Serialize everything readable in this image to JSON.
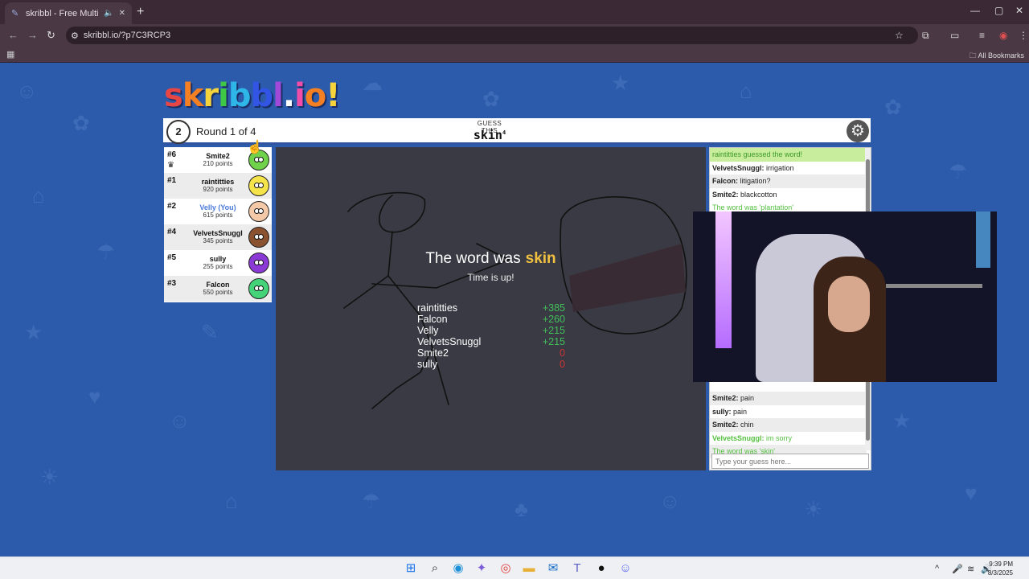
{
  "browser": {
    "tab_title": "skribbl - Free Multiplayer D",
    "url": "skribbl.io/?p7C3RCP3",
    "all_bookmarks": "All Bookmarks"
  },
  "logo": {
    "letters": [
      "s",
      "k",
      "r",
      "i",
      "b",
      "b",
      "l",
      ".",
      "i",
      "o",
      "!"
    ],
    "colors": [
      "#e84545",
      "#f57f23",
      "#f6d33a",
      "#3fc746",
      "#2fb6e8",
      "#3355e6",
      "#a14ad9",
      "#ffffff",
      "#f04ca8",
      "#f57f23",
      "#f6d33a"
    ]
  },
  "header": {
    "timer": "2",
    "round": "Round 1 of 4",
    "guess_label": "GUESS THIS",
    "word": "skin",
    "word_length": "4"
  },
  "players": [
    {
      "rank": "#6",
      "name": "Smite2",
      "points": "210 points",
      "avatar_color": "#6fd24a",
      "crown": true,
      "you": false
    },
    {
      "rank": "#1",
      "name": "raintitties",
      "points": "920 points",
      "avatar_color": "#f5e34a",
      "crown": false,
      "you": false
    },
    {
      "rank": "#2",
      "name": "Velly (You)",
      "points": "615 points",
      "avatar_color": "#f3c9a8",
      "crown": false,
      "you": true
    },
    {
      "rank": "#4",
      "name": "VelvetsSnuggl",
      "points": "345 points",
      "avatar_color": "#8b5230",
      "crown": false,
      "you": false
    },
    {
      "rank": "#5",
      "name": "sully",
      "points": "255 points",
      "avatar_color": "#8b3ad6",
      "crown": false,
      "you": false
    },
    {
      "rank": "#3",
      "name": "Falcon",
      "points": "550 points",
      "avatar_color": "#45d37a",
      "crown": false,
      "you": false
    }
  ],
  "reveal": {
    "prefix": "The word was",
    "word": "skin",
    "subtitle": "Time is up!",
    "results": [
      {
        "name": "raintitties",
        "score": "+385"
      },
      {
        "name": "Falcon",
        "score": "+260"
      },
      {
        "name": "Velly",
        "score": "+215"
      },
      {
        "name": "VelvetsSnuggl",
        "score": "+215"
      },
      {
        "name": "Smite2",
        "score": "0"
      },
      {
        "name": "sully",
        "score": "0"
      }
    ]
  },
  "chat": {
    "top_messages": [
      {
        "user": "",
        "text": "raintitties guessed the word!",
        "style": "greenbg"
      },
      {
        "user": "VelvetsSnuggl:",
        "text": " irrigation",
        "style": ""
      },
      {
        "user": "Falcon:",
        "text": " litigation?",
        "style": "alt"
      },
      {
        "user": "Smite2:",
        "text": " blackcotton",
        "style": ""
      },
      {
        "user": "",
        "text": "The word was 'plantation'",
        "style": "green"
      }
    ],
    "bottom_messages": [
      {
        "user": "Smite2:",
        "text": " pain",
        "style": "alt"
      },
      {
        "user": "sully:",
        "text": " pain",
        "style": ""
      },
      {
        "user": "Smite2:",
        "text": " chin",
        "style": "alt"
      },
      {
        "user": "VelvetsSnuggl:",
        "text": " im sorry",
        "style": "green"
      },
      {
        "user": "",
        "text": "The word was 'skin'",
        "style": "green alt"
      }
    ],
    "input_placeholder": "Type your guess here..."
  },
  "taskbar": {
    "time": "9:39 PM",
    "date": "8/3/2025"
  }
}
